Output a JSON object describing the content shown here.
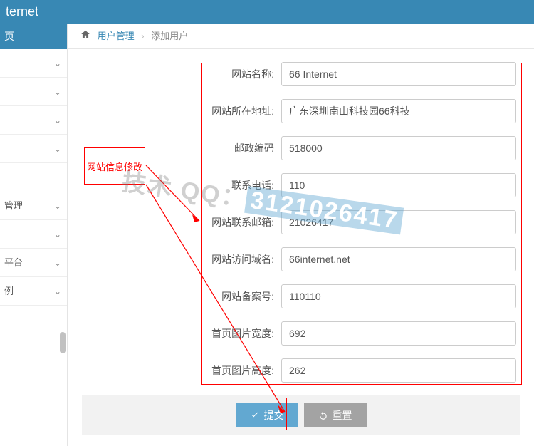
{
  "topbar": {
    "title": "ternet"
  },
  "sidebar": {
    "tab": "页",
    "items": [
      "",
      "",
      "",
      "",
      "管理",
      "",
      "平台",
      "例"
    ]
  },
  "breadcrumb": {
    "link": "用户管理",
    "current": "添加用户"
  },
  "form": {
    "site_name": {
      "label": "网站名称:",
      "value": "66 Internet"
    },
    "site_addr": {
      "label": "网站所在地址:",
      "value": "广东深圳南山科技园66科技"
    },
    "postcode": {
      "label": "邮政编码",
      "value": "518000"
    },
    "phone": {
      "label": "联系电话:",
      "value": "110"
    },
    "email": {
      "label": "网站联系邮箱:",
      "value": "21026417"
    },
    "domain": {
      "label": "网站访问域名:",
      "value": "66internet.net"
    },
    "icp": {
      "label": "网站备案号:",
      "value": "110110"
    },
    "img_w": {
      "label": "首页图片宽度:",
      "value": "692"
    },
    "img_h": {
      "label": "首页图片高度:",
      "value": "262"
    }
  },
  "buttons": {
    "submit": "提交",
    "reset": "重置"
  },
  "annotation": {
    "label": "网站信息修改"
  },
  "watermark": {
    "text": "技术 QQ：",
    "num": "3121026417"
  }
}
